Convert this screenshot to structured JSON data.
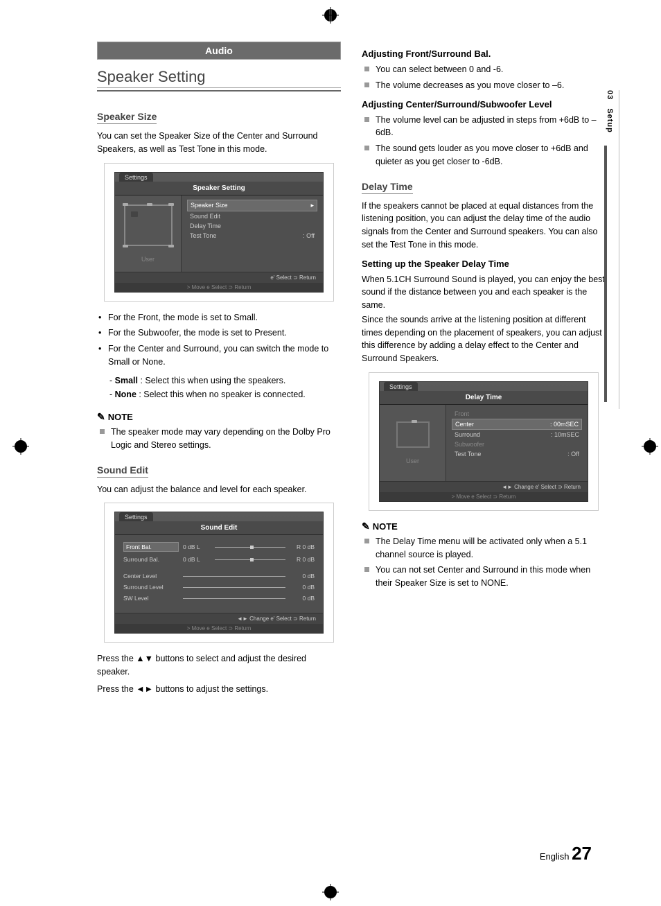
{
  "sideTab": {
    "chapter": "03",
    "name": "Setup"
  },
  "banner": "Audio",
  "left": {
    "title": "Speaker Setting",
    "speakerSize": {
      "heading": "Speaker Size",
      "intro": "You can set the Speaker Size of the Center and Surround Speakers, as well as Test Tone in this mode.",
      "bullets": [
        "For the Front, the mode is set to Small.",
        "For the Subwoofer, the mode is set to Present.",
        "For the Center and Surround, you can switch the mode to Small or None."
      ],
      "sub": [
        {
          "label": "Small",
          "text": " : Select this when using the speakers."
        },
        {
          "label": "None",
          "text": " : Select this when no speaker is connected."
        }
      ],
      "noteHead": "NOTE",
      "note": "The speaker mode may vary depending on the Dolby Pro Logic and Stereo settings."
    },
    "soundEdit": {
      "heading": "Sound Edit",
      "intro": "You can adjust the balance and level for each speaker.",
      "press1": "Press the ▲▼ buttons to select and adjust the desired speaker.",
      "press2": "Press the ◄► buttons to adjust the settings."
    },
    "osd1": {
      "tab": "Settings",
      "header": "Speaker Setting",
      "user": "User",
      "items": {
        "speakerSize": "Speaker Size",
        "soundEdit": "Sound Edit",
        "delayTime": "Delay Time",
        "testTone": "Test Tone",
        "testToneVal": ": Off"
      },
      "footer": "e' Select   ⊃ Return",
      "ghost": "> Move   e Select   ⊃ Return"
    },
    "osd2": {
      "tab": "Settings",
      "header": "Sound Edit",
      "rows": {
        "frontBal": {
          "label": "Front Bal.",
          "left": "0 dB L",
          "right": "R 0 dB"
        },
        "surroundBal": {
          "label": "Surround Bal.",
          "left": "0 dB L",
          "right": "R 0 dB"
        },
        "centerLevel": {
          "label": "Center Level",
          "val": "0 dB"
        },
        "surroundLevel": {
          "label": "Surround Level",
          "val": "0 dB"
        },
        "swLevel": {
          "label": "SW Level",
          "val": "0 dB"
        }
      },
      "footer": "◄► Change  e' Select   ⊃ Return",
      "ghost": "> Move   e Select   ⊃ Return"
    }
  },
  "right": {
    "adjBal": {
      "heading": "Adjusting Front/Surround Bal.",
      "items": [
        "You can select between 0 and -6.",
        "The volume decreases as you move closer to –6."
      ]
    },
    "adjLevel": {
      "heading": "Adjusting Center/Surround/Subwoofer Level",
      "items": [
        "The volume level can be adjusted in steps from +6dB to –6dB.",
        "The sound gets louder as you move closer to +6dB and quieter as you get closer to -6dB."
      ]
    },
    "delayTime": {
      "heading": "Delay Time",
      "intro": "If the speakers cannot be placed at equal distances from the listening position, you can adjust the delay time of the audio signals from the Center and Surround speakers. You can also set the Test Tone in this mode."
    },
    "setupDelay": {
      "heading": "Setting up the Speaker Delay Time",
      "p1": "When 5.1CH Surround Sound is played, you can enjoy the best sound if the distance between you and each speaker is the same.",
      "p2": "Since the sounds arrive at the listening position at different times depending on the placement of speakers, you can adjust this difference by adding a delay effect to the Center and Surround Speakers."
    },
    "osd3": {
      "tab": "Settings",
      "header": "Delay Time",
      "user": "User",
      "items": {
        "front": "Front",
        "center": {
          "label": "Center",
          "val": ": 00mSEC"
        },
        "surround": {
          "label": "Surround",
          "val": ": 10mSEC"
        },
        "subwoofer": "Subwoofer",
        "testTone": {
          "label": "Test Tone",
          "val": ": Off"
        }
      },
      "footer": "◄► Change  e' Select   ⊃ Return",
      "ghost": "> Move   e Select   ⊃ Return"
    },
    "noteHead": "NOTE",
    "notes": [
      "The Delay Time menu will be activated only when a 5.1 channel source is played.",
      "You can not set Center and Surround in this mode when their Speaker Size is set to NONE."
    ]
  },
  "footer": {
    "lang": "English",
    "page": "27"
  }
}
